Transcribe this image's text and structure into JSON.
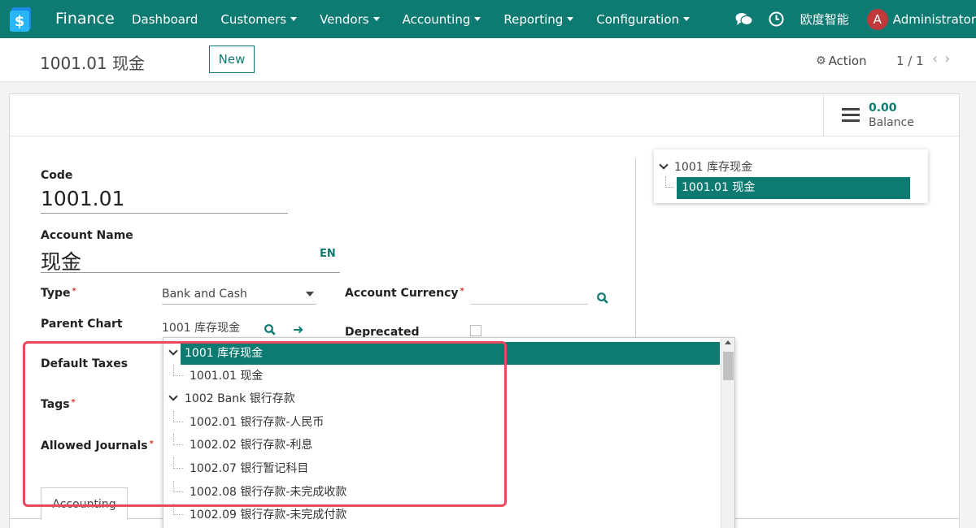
{
  "navbar": {
    "app_name": "Finance",
    "menu": [
      {
        "label": "Dashboard",
        "dropdown": false
      },
      {
        "label": "Customers",
        "dropdown": true
      },
      {
        "label": "Vendors",
        "dropdown": true
      },
      {
        "label": "Accounting",
        "dropdown": true
      },
      {
        "label": "Reporting",
        "dropdown": true
      },
      {
        "label": "Configuration",
        "dropdown": true
      }
    ],
    "company": "欧度智能",
    "avatar_letter": "A",
    "user": "Administrator",
    "icons": [
      "chat-icon",
      "clock-icon"
    ]
  },
  "control_panel": {
    "title": "1001.01 现金",
    "new_label": "New",
    "action_label": "Action",
    "pager": "1 / 1"
  },
  "button_box": {
    "balance_value": "0.00",
    "balance_label": "Balance"
  },
  "form": {
    "code_label": "Code",
    "code_value": "1001.01",
    "name_label": "Account Name",
    "name_value": "现金",
    "lang_label": "EN",
    "type_label": "Type",
    "type_value": "Bank and Cash",
    "currency_label": "Account Currency",
    "parent_label": "Parent Chart",
    "parent_value": "1001 库存现金",
    "deprecated_label": "Deprecated",
    "taxes_label": "Default Taxes",
    "tags_label": "Tags",
    "journals_label": "Allowed Journals",
    "required_mark": "*"
  },
  "tree": {
    "root": "1001 库存现金",
    "child": "1001.01 现金"
  },
  "tabs": {
    "accounting": "Accounting"
  },
  "dropdown": {
    "items": [
      {
        "label": "1001 库存现金",
        "level": 0,
        "active": true
      },
      {
        "label": "1001.01 现金",
        "level": 1,
        "active": false
      },
      {
        "label": "1002 Bank 银行存款",
        "level": 0,
        "active": false
      },
      {
        "label": "1002.01 银行存款-人民币",
        "level": 1,
        "active": false
      },
      {
        "label": "1002.02 银行存款-利息",
        "level": 1,
        "active": false
      },
      {
        "label": "1002.07 银行暂记科目",
        "level": 1,
        "active": false
      },
      {
        "label": "1002.08 银行存款-未完成收款",
        "level": 1,
        "active": false
      },
      {
        "label": "1002.09 银行存款-未完成付款",
        "level": 1,
        "active": false
      }
    ]
  },
  "colors": {
    "brand": "#0e7b72",
    "highlight": "#e8495e",
    "avatar": "#c0393b"
  }
}
